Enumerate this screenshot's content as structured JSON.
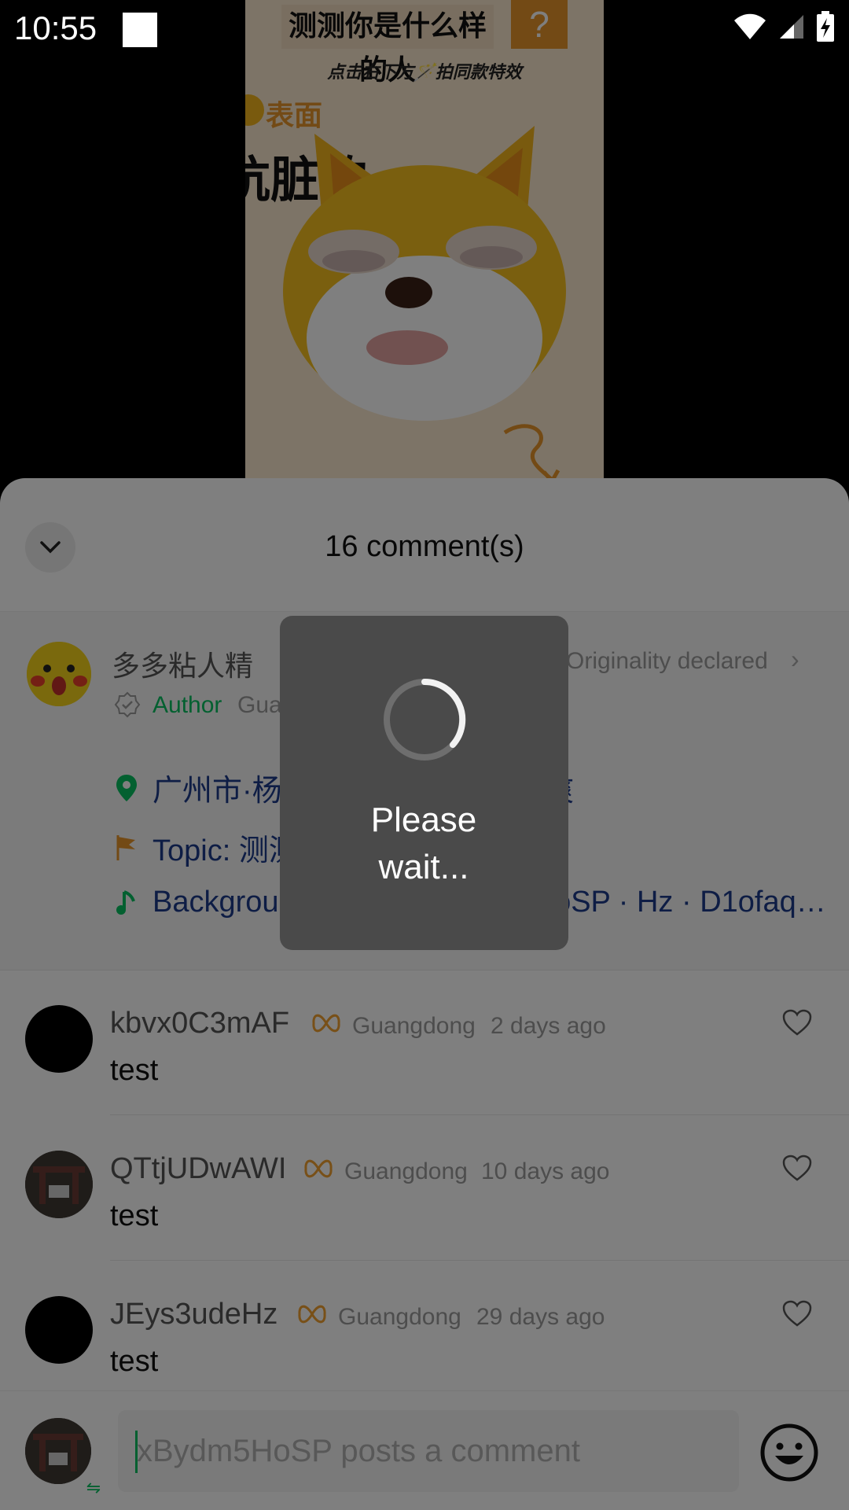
{
  "status_bar": {
    "time": "10:55"
  },
  "video": {
    "title": "测测你是什么样的人",
    "question_mark": "?",
    "subtitle": "点击右下方🪄拍同款特效",
    "tag1": "表面",
    "tag2": "肮脏的"
  },
  "sheet": {
    "title": "16 comment(s)",
    "author": {
      "name": "多多粘人精",
      "originality": "Originality declared",
      "badge": "Author",
      "region": "Guangdong"
    },
    "meta": {
      "location": "广州市·杨箕村 · 我的快乐 · 好爽",
      "topic": "Topic: 测测你是什么样的人",
      "music": "Background music · xBydm5HoSP · Hz · D1ofaquavi..."
    },
    "comments": [
      {
        "name": "kbvx0C3mAF",
        "region": "Guangdong",
        "time": "2 days ago",
        "text": "test"
      },
      {
        "name": "QTtjUDwAWI",
        "region": "Guangdong",
        "time": "10 days ago",
        "text": "test"
      },
      {
        "name": "JEys3udeHz",
        "region": "Guangdong",
        "time": "29 days ago",
        "text": "test"
      }
    ],
    "input": {
      "placeholder": "xBydm5HoSP posts a comment"
    }
  },
  "loading": {
    "text": "Please wait..."
  },
  "colors": {
    "accent_green": "#07c160",
    "link_blue": "#1d3b8a",
    "badge_orange": "#e7952a",
    "dialog_bg": "#4a4a4a"
  }
}
